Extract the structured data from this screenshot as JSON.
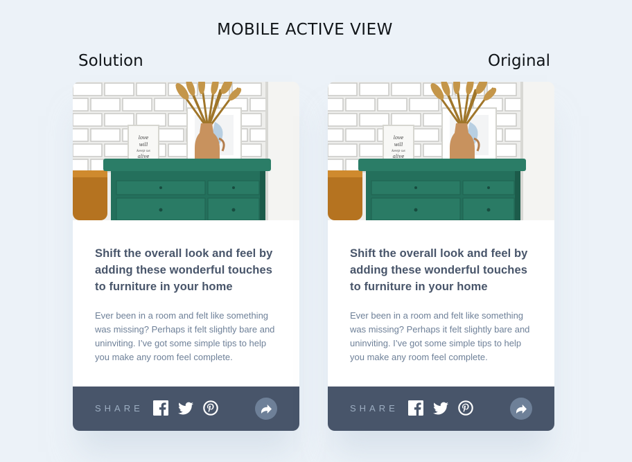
{
  "page": {
    "title": "MOBILE ACTIVE VIEW",
    "solution_label": "Solution",
    "original_label": "Original"
  },
  "card": {
    "image": "drawers-photo",
    "headline": "Shift the overall look and feel by adding these wonderful touches to furniture in your home",
    "excerpt": "Ever been in a room and felt like something was missing? Perhaps it felt slightly bare and uninviting. I’ve got some simple tips to help you make any room feel complete.",
    "share_label": "SHARE",
    "frame_text": [
      "love",
      "will",
      "keep us",
      "alive"
    ],
    "icons": [
      "facebook-icon",
      "twitter-icon",
      "pinterest-icon",
      "share-arrow-icon"
    ]
  },
  "colors": {
    "background": "#ecf2f8",
    "share_bar": "#48556a",
    "share_button": "#6e8098",
    "headline": "#48556a",
    "excerpt": "#6e8098",
    "share_text": "#9daec2"
  }
}
